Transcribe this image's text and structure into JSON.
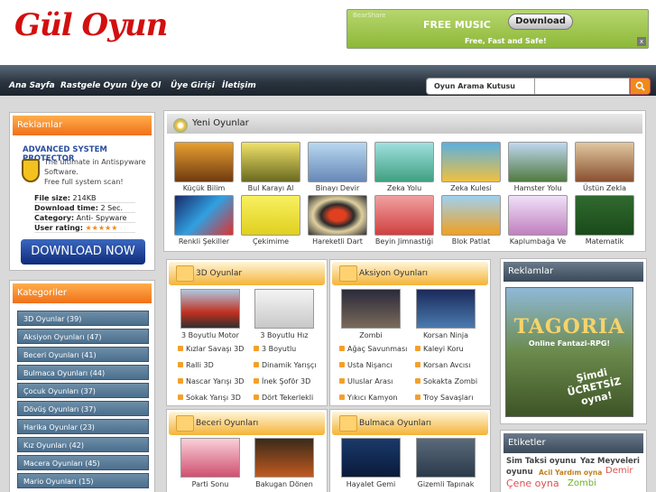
{
  "site": {
    "logo": "Gül Oyun"
  },
  "banner": {
    "brand": "BearShare",
    "title": "FREE MUSIC",
    "button": "Download",
    "tagline": "Free, Fast and Safe!",
    "close": "x"
  },
  "nav": {
    "items": [
      "Ana Sayfa",
      "Rastgele Oyun",
      "Üye Ol",
      "Üye Girişi",
      "İletişim"
    ]
  },
  "search": {
    "label": "Oyun Arama Kutusu",
    "placeholder": ""
  },
  "left_ad": {
    "title": "Reklamlar",
    "product": "ADVANCED SYSTEM PROTECTOR",
    "desc1": "The ultimate in Antispyware Software.",
    "desc2": "Free full system scan!",
    "rows": [
      {
        "k": "File size:",
        "v": "214KB"
      },
      {
        "k": "Download time:",
        "v": "2 Sec."
      },
      {
        "k": "Category:",
        "v": "Anti- Spyware"
      },
      {
        "k": "User rating:",
        "v": "★★★★★"
      }
    ],
    "button": "DOWNLOAD NOW"
  },
  "categories": {
    "title": "Kategoriler",
    "items": [
      "3D Oyunlar (39)",
      "Aksiyon Oyunları (47)",
      "Beceri Oyunları (41)",
      "Bulmaca Oyunları (44)",
      "Çocuk Oyunları (37)",
      "Dövüş Oyunları (37)",
      "Harika Oyunlar (23)",
      "Kız Oyunları (42)",
      "Macera Oyunları (45)",
      "Mario Oyunları (15)"
    ]
  },
  "new_games": {
    "title": "Yeni Oyunlar",
    "row1": [
      "Küçük Bilim",
      "Bul Karayı Al",
      "Binayı Devir",
      "Zeka Yolu",
      "Zeka Kulesi",
      "Hamster Yolu",
      "Üstün Zekla"
    ],
    "row2": [
      "Renkli Şekiller",
      "Çekimime",
      "Hareketli Dart",
      "Beyin Jimnastiği",
      "Blok Patlat",
      "Kaplumbağa Ve",
      "Matematik"
    ]
  },
  "box_3d": {
    "title": "3D Oyunlar",
    "games": [
      "3 Boyutlu Motor",
      "3 Boyutlu Hız"
    ],
    "links": [
      "Kızlar Savaşı 3D",
      "3 Boyutlu",
      "Ralli 3D",
      "Dinamik Yarışçı",
      "Nascar Yarışı 3D",
      "İnek Şoför 3D",
      "Sokak Yarışı 3D",
      "Dört Tekerlekli"
    ]
  },
  "box_aksiyon": {
    "title": "Aksiyon Oyunları",
    "games": [
      "Zombi",
      "Korsan Ninja"
    ],
    "links": [
      "Ağaç Savunması",
      "Kaleyi Koru",
      "Usta Nişancı",
      "Korsan Avcısı",
      "Uluslar Arası",
      "Sokakta Zombi",
      "Yıkıcı Kamyon",
      "Troy Savaşları"
    ]
  },
  "box_beceri": {
    "title": "Beceri Oyunları",
    "games": [
      "Parti Sonu",
      "Bakugan Dönen"
    ]
  },
  "box_bulmaca": {
    "title": "Bulmaca Oyunları",
    "games": [
      "Hayalet Gemi",
      "Gizemli Tapınak"
    ]
  },
  "right_ad": {
    "title": "Reklamlar",
    "img_title": "TAGORIA",
    "img_sub": "Online Fantazi-RPG!",
    "img_cta": "Şimdi ÜCRETSİZ oyna!"
  },
  "tags": {
    "title": "Etiketler",
    "items": [
      "Sim Taksi oyunu",
      "Yaz Meyveleri",
      "oyunu",
      "Acil Yardım oyna",
      "Demir",
      "Çene oyna",
      "Zombi"
    ]
  },
  "colors": {
    "accent": "#f0701a",
    "brand": "#d20f0f",
    "nav": "#2b3540"
  }
}
